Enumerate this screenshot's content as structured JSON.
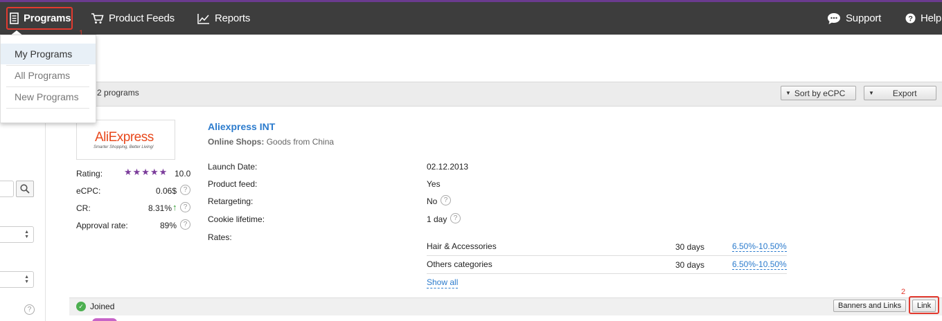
{
  "nav": {
    "programs": "Programs",
    "product_feeds": "Product Feeds",
    "reports": "Reports",
    "support": "Support",
    "help": "Help"
  },
  "annotations": {
    "step1": "1",
    "step2": "2"
  },
  "dropdown": {
    "items": [
      {
        "label": "My Programs",
        "active": true
      },
      {
        "label": "All Programs",
        "active": false
      },
      {
        "label": "New Programs",
        "active": false
      }
    ]
  },
  "list_header": {
    "found_text": "d 2 programs",
    "sort_label": "Sort by eCPC",
    "export_label": "Export"
  },
  "program": {
    "logo_text": "AliExpress",
    "logo_tagline": "Smarter Shopping, Better Living!",
    "name": "Aliexpress INT",
    "category_label": "Online Shops:",
    "category_value": "Goods from China",
    "stats": {
      "rating_label": "Rating:",
      "rating_stars": "★★★★★",
      "rating_value": "10.0",
      "ecpc_label": "eCPC:",
      "ecpc_value": "0.06$",
      "cr_label": "CR:",
      "cr_value": "8.31%",
      "approval_label": "Approval rate:",
      "approval_value": "89%"
    },
    "details": [
      {
        "label": "Launch Date:",
        "value": "02.12.2013"
      },
      {
        "label": "Product feed:",
        "value": "Yes"
      },
      {
        "label": "Retargeting:",
        "value": "No"
      },
      {
        "label": "Cookie lifetime:",
        "value": "1 day"
      },
      {
        "label": "Rates:",
        "value": ""
      }
    ],
    "rates": [
      {
        "category": "Hair & Accessories",
        "days": "30 days",
        "rate": "6.50%-10.50%"
      },
      {
        "category": "Others categories",
        "days": "30 days",
        "rate": "6.50%-10.50%"
      }
    ],
    "show_all": "Show all",
    "status": "Joined",
    "banners_button": "Banners and Links",
    "link_button": "Link"
  },
  "colors": {
    "accent_red": "#e23a2f",
    "link_blue": "#2b7bcd",
    "topbar": "#3d3d3d",
    "star_purple": "#7b3c9b"
  }
}
